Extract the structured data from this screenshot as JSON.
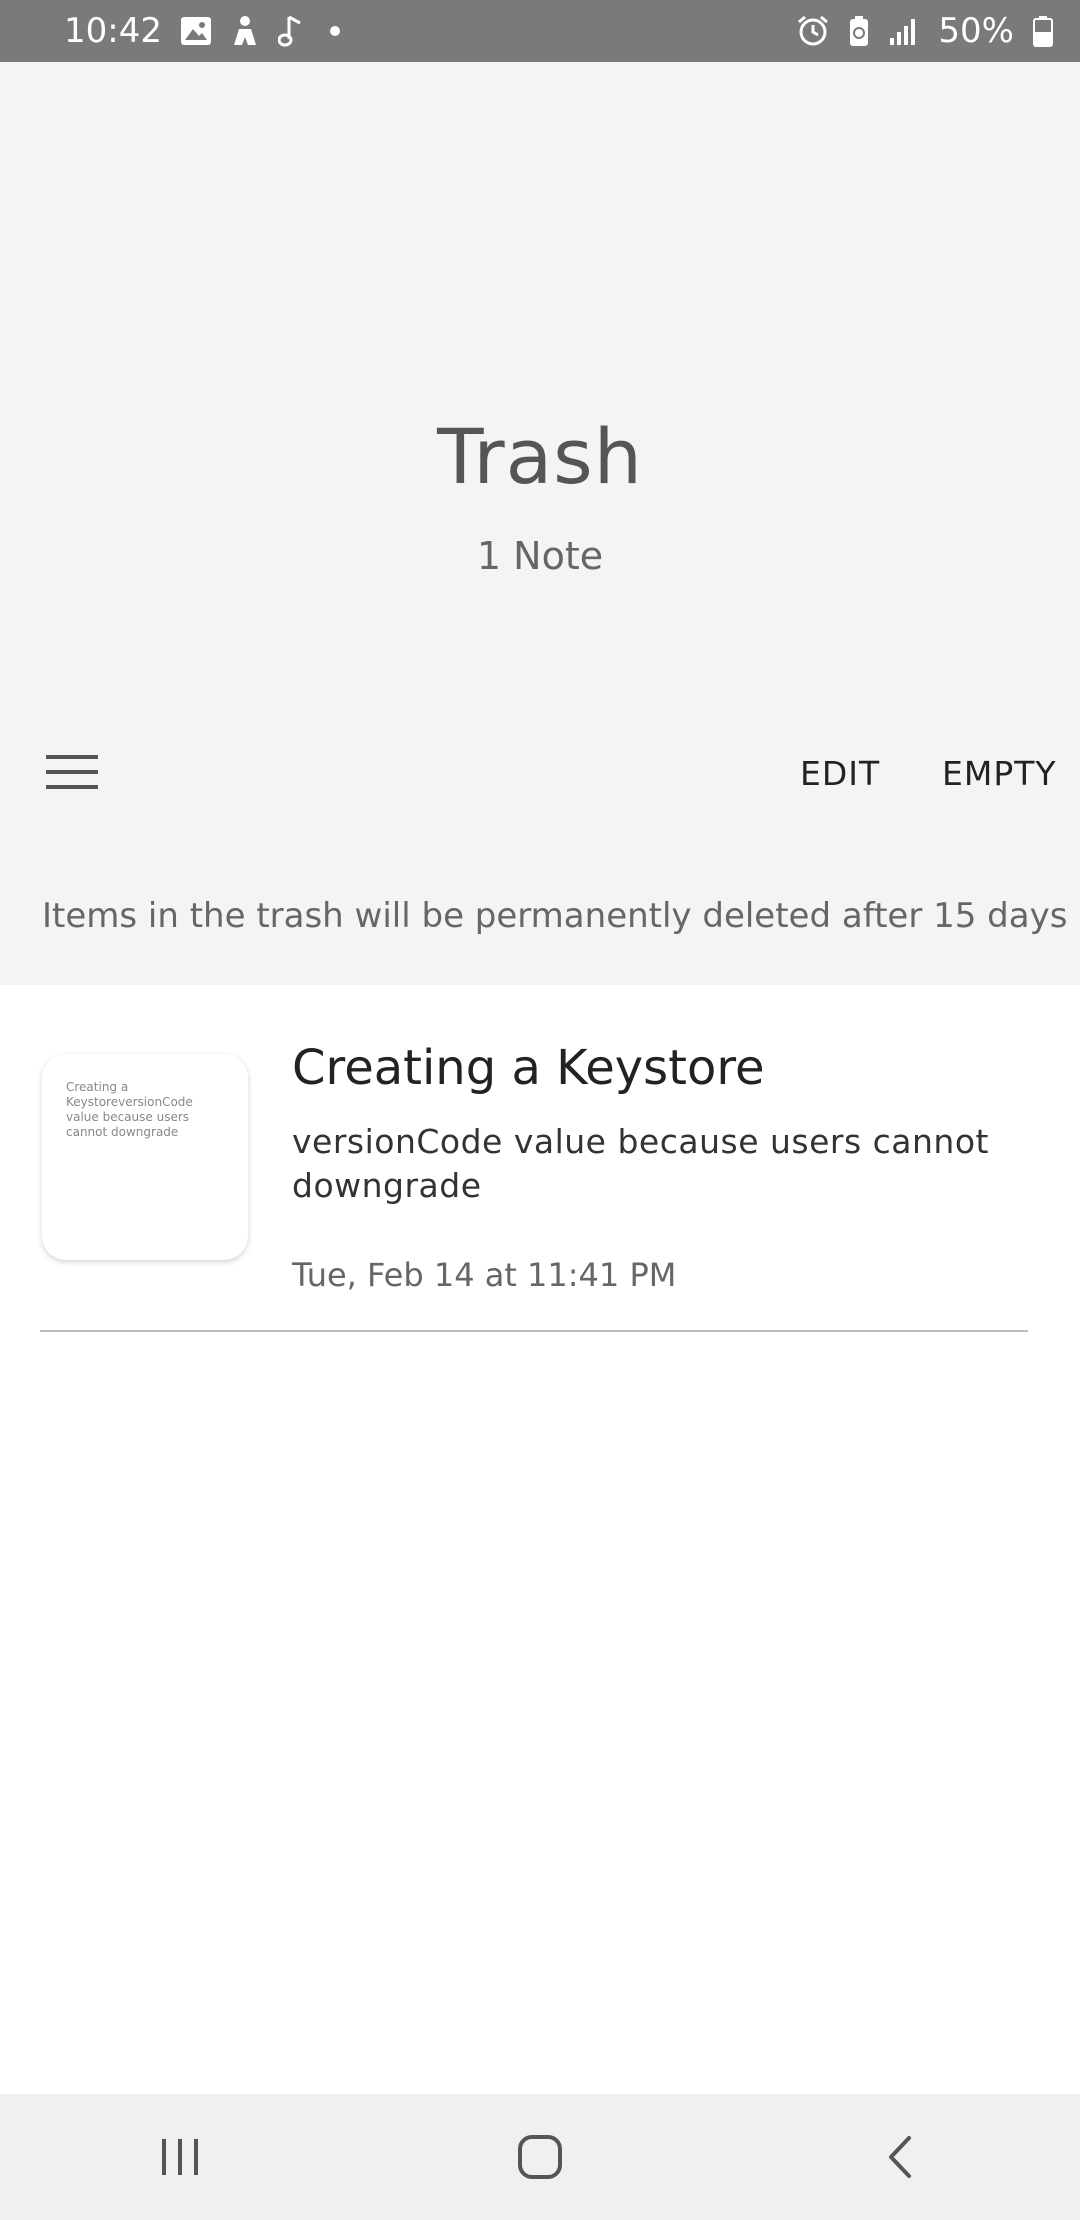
{
  "status_bar": {
    "time": "10:42",
    "battery": "50%",
    "icons_left": [
      "image-icon",
      "person-icon",
      "music-note-icon",
      "dot-icon"
    ],
    "icons_right": [
      "alarm-icon",
      "battery-saver-icon",
      "signal-icon",
      "battery-icon"
    ]
  },
  "header": {
    "title": "Trash",
    "count": "1 Note",
    "edit_label": "EDIT",
    "empty_label": "EMPTY",
    "notice": "Items in the trash will be permanently deleted after 15 days"
  },
  "notes": [
    {
      "title": "Creating a Keystore",
      "preview": "versionCode value because users cannot downgrade",
      "thumbnail_text": "Creating a KeystoreversionCode value because users cannot downgrade",
      "date": "Tue, Feb 14 at 11:41 PM"
    }
  ],
  "nav_bar": {
    "icons": [
      "recent-apps-icon",
      "home-icon",
      "back-icon"
    ]
  }
}
